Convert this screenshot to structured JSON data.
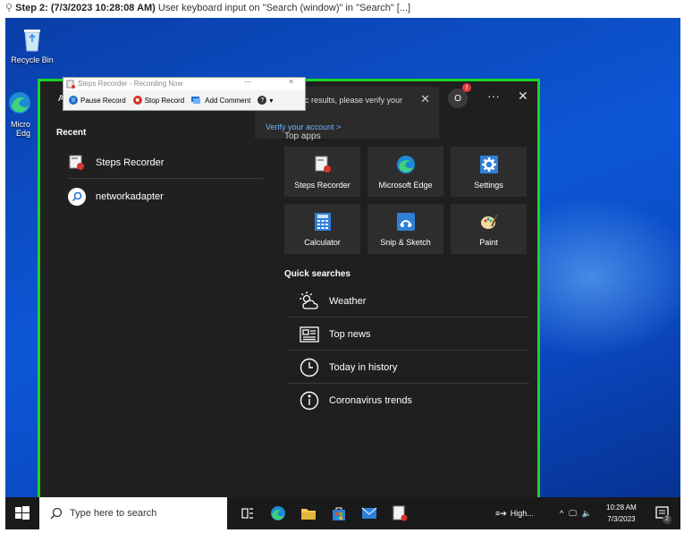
{
  "caption": {
    "step_label": "Step 2: (7/3/2023 10:28:08 AM)",
    "description": " User keyboard input on \"Search (window)\" in \"Search\" [...]"
  },
  "desktop": {
    "recycle_bin_label": "Recycle Bin",
    "edge_label_line1": "Micro",
    "edge_label_line2": "Edg"
  },
  "steps_recorder": {
    "title": "Steps Recorder - Recording Now",
    "pause_label": "Pause Record",
    "stop_label": "Stop Record",
    "comment_label": "Add Comment"
  },
  "start_menu": {
    "tab_all": "Al",
    "recent_title": "Recent",
    "recent_items": [
      {
        "label": "Steps Recorder",
        "icon": "steps-recorder-icon"
      },
      {
        "label": "networkadapter",
        "icon": "search-icon"
      }
    ],
    "notification": {
      "text": "c results, please verify your",
      "link": "Verify your account >"
    },
    "avatar_initial": "O",
    "badge": "!",
    "more": "···",
    "close": "✕",
    "top_apps_title": "Top apps",
    "top_apps": [
      {
        "label": "Steps Recorder",
        "icon": "steps-recorder-icon",
        "color": "#ffffff"
      },
      {
        "label": "Microsoft Edge",
        "icon": "edge-icon",
        "color": "#2bb0e6"
      },
      {
        "label": "Settings",
        "icon": "gear-icon",
        "color": "#3b8ee6"
      },
      {
        "label": "Calculator",
        "icon": "calculator-icon",
        "color": "#3b8ee6"
      },
      {
        "label": "Snip & Sketch",
        "icon": "snip-icon",
        "color": "#3b8ee6"
      },
      {
        "label": "Paint",
        "icon": "paint-icon",
        "color": "#e6c55a"
      }
    ],
    "quick_searches_title": "Quick searches",
    "quick_searches": [
      {
        "label": "Weather",
        "icon": "weather-icon"
      },
      {
        "label": "Top news",
        "icon": "news-icon"
      },
      {
        "label": "Today in history",
        "icon": "clock-icon"
      },
      {
        "label": "Coronavirus trends",
        "icon": "info-icon"
      }
    ]
  },
  "taskbar": {
    "search_placeholder": "Type here to search",
    "weather_text": "High...",
    "time": "10:28 AM",
    "date": "7/3/2023",
    "notification_count": "2"
  }
}
